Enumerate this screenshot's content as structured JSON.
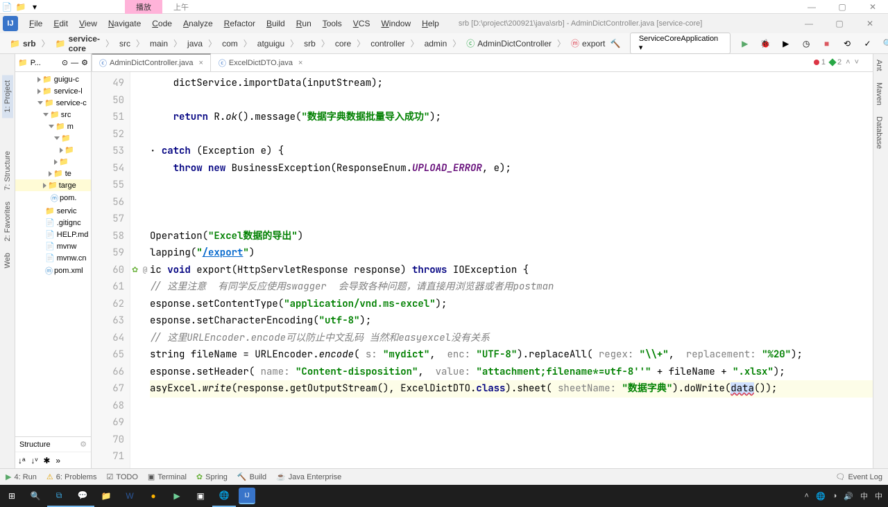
{
  "topbar": {
    "tab_play": "播放",
    "tab_am": "上午"
  },
  "menu": [
    "File",
    "Edit",
    "View",
    "Navigate",
    "Code",
    "Analyze",
    "Refactor",
    "Build",
    "Run",
    "Tools",
    "VCS",
    "Window",
    "Help"
  ],
  "title": "srb [D:\\project\\200921\\java\\srb] - AdminDictController.java [service-core]",
  "breadcrumb": [
    "srb",
    "service-core",
    "src",
    "main",
    "java",
    "com",
    "atguigu",
    "srb",
    "core",
    "controller",
    "admin",
    "AdminDictController",
    "export"
  ],
  "run_config": "ServiceCoreApplication",
  "left_tools": {
    "project": "1: Project",
    "structure": "7: Structure",
    "favorites": "2: Favorites",
    "web": "Web"
  },
  "right_tools": {
    "ant": "Ant",
    "maven": "Maven",
    "database": "Database"
  },
  "tree_header": "P...",
  "tree": [
    {
      "label": "guigu-c",
      "indent": 3
    },
    {
      "label": "service-l",
      "indent": 3
    },
    {
      "label": "service-c",
      "indent": 3,
      "open": true
    },
    {
      "label": "src",
      "indent": 4,
      "open": true,
      "blue": true
    },
    {
      "label": "m",
      "indent": 5,
      "open": true
    },
    {
      "label": "",
      "indent": 6,
      "open": true
    },
    {
      "label": "",
      "indent": 7
    },
    {
      "label": "",
      "indent": 6
    },
    {
      "label": "te",
      "indent": 5
    },
    {
      "label": "targe",
      "indent": 4,
      "red": true,
      "sel": true
    },
    {
      "label": "pom.",
      "indent": 4,
      "file": true
    },
    {
      "label": "servic",
      "indent": 3,
      "gitignore": true
    },
    {
      "label": ".gitignc",
      "indent": 3,
      "file": true
    },
    {
      "label": "HELP.md",
      "indent": 3,
      "file": true
    },
    {
      "label": "mvnw",
      "indent": 3,
      "file": true
    },
    {
      "label": "mvnw.cn",
      "indent": 3,
      "file": true
    },
    {
      "label": "pom.xml",
      "indent": 3,
      "file": true
    }
  ],
  "structure": "Structure",
  "tabs": [
    {
      "name": "AdminDictController.java",
      "active": true
    },
    {
      "name": "ExcelDictDTO.java",
      "active": false
    }
  ],
  "lines": [
    49,
    50,
    51,
    52,
    53,
    54,
    55,
    56,
    57,
    58,
    59,
    60,
    61,
    62,
    63,
    64,
    65,
    66,
    67,
    68,
    69,
    70,
    71
  ],
  "badges": {
    "errors": "1",
    "warnings": "2"
  },
  "code": {
    "l49": "dictService.importData(inputStream);",
    "l51_ret": "return",
    "l51_r": " R.",
    "l51_ok": "ok",
    "l51_rest": "().message(",
    "l51_str": "\"数据字典数据批量导入成功\"",
    "l51_end": ");",
    "l53_catch": "catch",
    "l53_rest": " (Exception e) {",
    "l54_throw": "throw ",
    "l54_new": "new",
    "l54_rest": " BusinessException(ResponseEnum.",
    "l54_const": "UPLOAD_ERROR",
    "l54_end": ", e);",
    "l58_a": "Operation(",
    "l58_str": "\"Excel数据的导出\"",
    "l58_b": ")",
    "l59_a": "lapping(",
    "l59_str": "\"/export\"",
    "l59_b": ")",
    "l60_a": "ic ",
    "l60_void": "void",
    "l60_b": " export(HttpServletResponse response) ",
    "l60_throws": "throws",
    "l60_c": " IOException {",
    "l61": "// 这里注意  有同学反应使用swagger  会导致各种问题，请直接用浏览器或者用postman",
    "l62_a": "esponse.setContentType(",
    "l62_str": "\"application/vnd.ms-excel\"",
    "l62_b": ");",
    "l63_a": "esponse.setCharacterEncoding(",
    "l63_str": "\"utf-8\"",
    "l63_b": ");",
    "l64": "// 这里URLEncoder.encode可以防止中文乱码 当然和easyexcel没有关系",
    "l65_a": "string fileName = URLEncoder.",
    "l65_m": "encode",
    "l65_b": "( ",
    "l65_p1": "s: ",
    "l65_s1": "\"mydict\"",
    "l65_c": ",  ",
    "l65_p2": "enc: ",
    "l65_s2": "\"UTF-8\"",
    "l65_d": ").replaceAll( ",
    "l65_p3": "regex: ",
    "l65_s3": "\"\\\\+\"",
    "l65_e": ",  ",
    "l65_p4": "replacement: ",
    "l65_s4": "\"%20\"",
    "l65_f": ");",
    "l66_a": "esponse.setHeader( ",
    "l66_p1": "name: ",
    "l66_s1": "\"Content-disposition\"",
    "l66_b": ",  ",
    "l66_p2": "value: ",
    "l66_s2": "\"attachment;filename*=utf-8''\"",
    "l66_c": " + fileName + ",
    "l66_s3": "\".xlsx\"",
    "l66_d": ");",
    "l67_a": "asyExcel.",
    "l67_m": "write",
    "l67_b": "(response.getOutputStream(), ExcelDictDTO.",
    "l67_cls": "class",
    "l67_c": ").sheet( ",
    "l67_p": "sheetName: ",
    "l67_s": "\"数据字典\"",
    "l67_d": ").doWrite(",
    "l67_data": "data",
    "l67_e": "());"
  },
  "bottom": {
    "run": "4: Run",
    "problems": "6: Problems",
    "todo": "TODO",
    "terminal": "Terminal",
    "spring": "Spring",
    "build": "Build",
    "je": "Java Enterprise",
    "event": "Event Log"
  },
  "systray": {
    "time1": "中",
    "time2": "中"
  }
}
